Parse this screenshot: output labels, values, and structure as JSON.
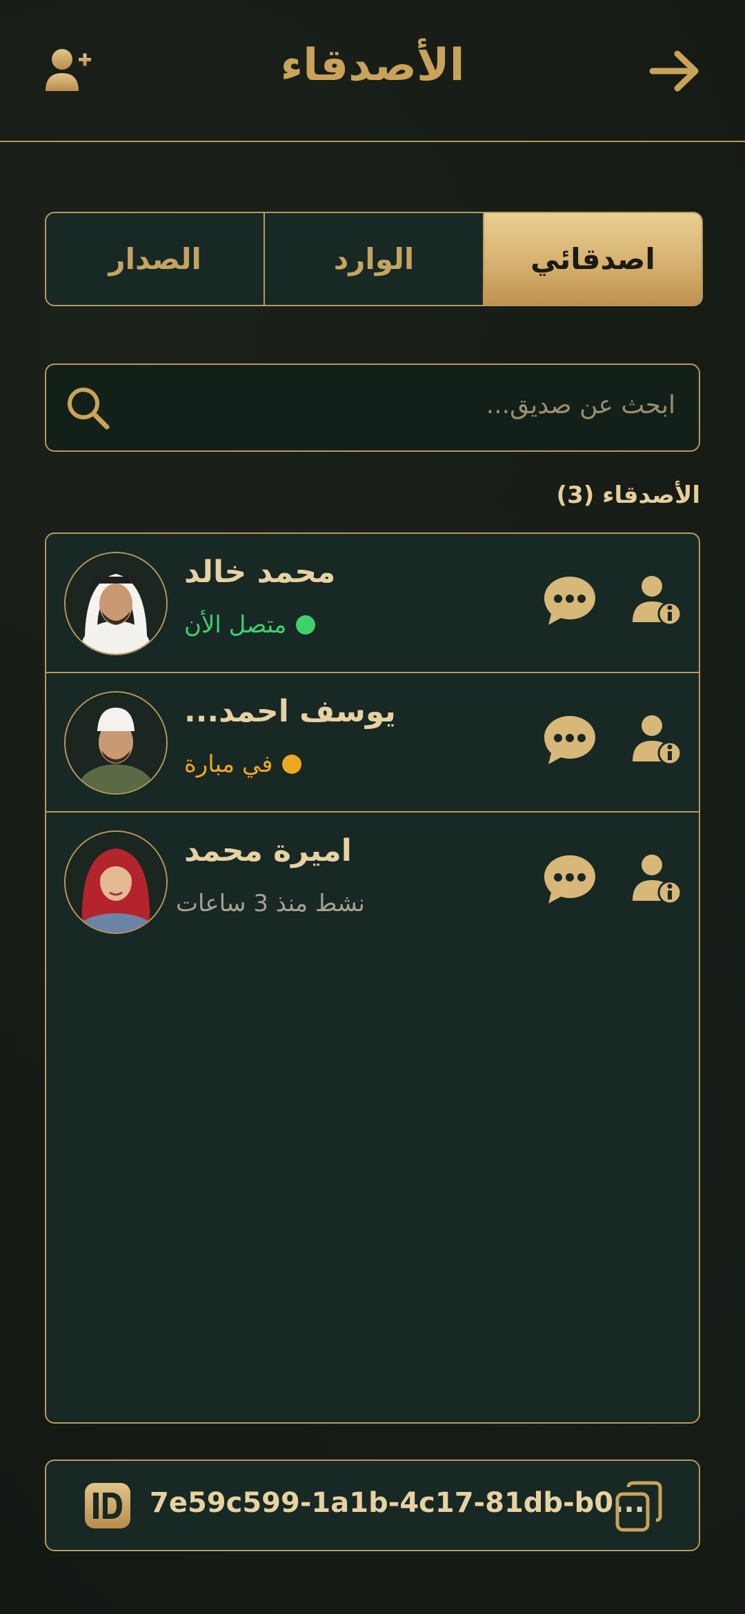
{
  "header": {
    "title": "الأصدقاء"
  },
  "tabs": [
    {
      "label": "اصدقائي",
      "active": true
    },
    {
      "label": "الوارد",
      "active": false
    },
    {
      "label": "الصدار",
      "active": false
    }
  ],
  "search": {
    "placeholder": "ابحث عن صديق..."
  },
  "friends_section": {
    "title": "الأصدقاء (3)"
  },
  "friends": [
    {
      "name": "محمد خالد",
      "status": "متصل الأن",
      "status_color": "#3fd16b",
      "dot": true
    },
    {
      "name": "يوسف احمد...",
      "status": "في مبارة",
      "status_color": "#f0a620",
      "dot": true
    },
    {
      "name": "اميرة محمد",
      "status": "نشط منذ 3 ساعات",
      "status_color": "#a6a394",
      "dot": false
    }
  ],
  "user_id": {
    "value": "7e59c599-1a1b-4c17-81db-b0..."
  },
  "colors": {
    "gold": "#c9a35a",
    "panel": "#182824",
    "border": "#b99a5c"
  }
}
